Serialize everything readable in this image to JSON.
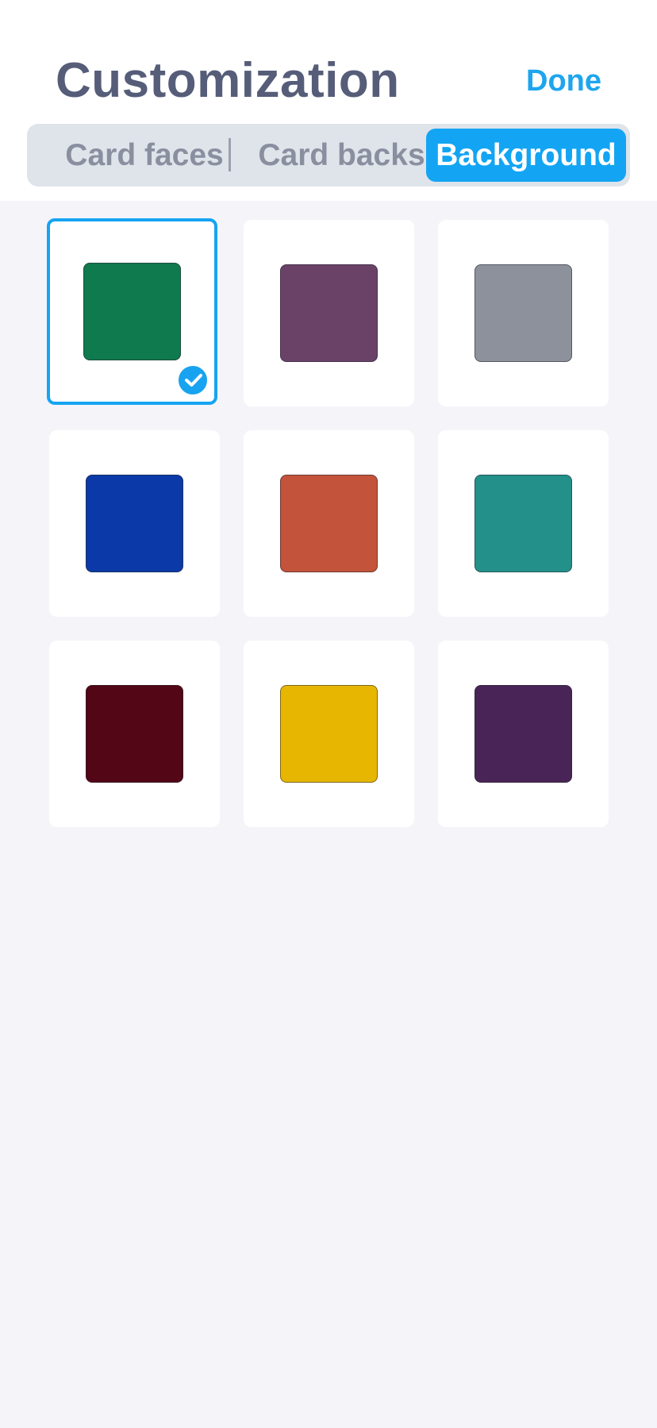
{
  "header": {
    "title": "Customization",
    "done_label": "Done"
  },
  "tabs": [
    {
      "label": "Card faces",
      "active": false
    },
    {
      "label": "Card backs",
      "active": false
    },
    {
      "label": "Background",
      "active": true
    }
  ],
  "backgrounds": [
    {
      "color": "#0f7a4d",
      "selected": true
    },
    {
      "color": "#6a4268",
      "selected": false
    },
    {
      "color": "#8d919b",
      "selected": false
    },
    {
      "color": "#0b3aa8",
      "selected": false
    },
    {
      "color": "#c3533a",
      "selected": false
    },
    {
      "color": "#23918a",
      "selected": false
    },
    {
      "color": "#520616",
      "selected": false
    },
    {
      "color": "#e6b600",
      "selected": false
    },
    {
      "color": "#482556",
      "selected": false
    }
  ],
  "colors": {
    "accent": "#13a5f3",
    "title": "#565d79",
    "inactive_tab": "#8a8fa0",
    "segmented_bg": "#dfe4eb",
    "page_bg": "#f5f5f9"
  },
  "icons": {
    "selected_marker": "checkmark-icon"
  }
}
